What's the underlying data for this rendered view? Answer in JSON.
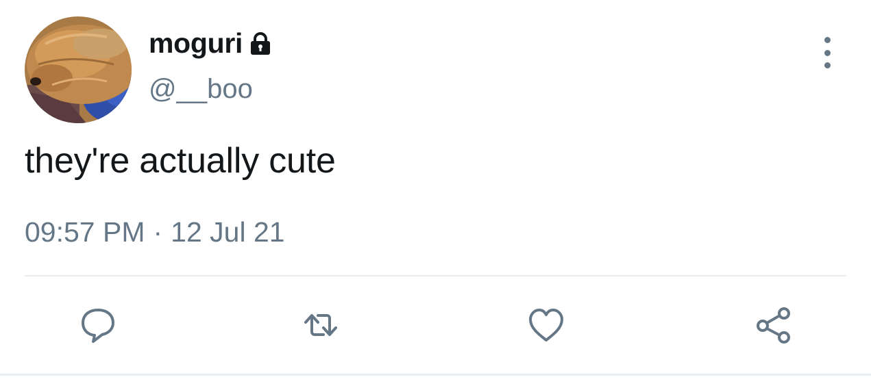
{
  "user": {
    "display_name": "moguri",
    "handle": "@__boo",
    "protected": true,
    "lock_icon": "lock-icon",
    "avatar_icon": "avatar-photo"
  },
  "tweet": {
    "text": "they're actually cute",
    "time": "09:57 PM",
    "separator": "·",
    "date": "12 Jul 21"
  },
  "actions": [
    {
      "name": "reply",
      "icon": "speech-bubble-icon"
    },
    {
      "name": "retweet",
      "icon": "retweet-icon"
    },
    {
      "name": "like",
      "icon": "heart-icon"
    },
    {
      "name": "share",
      "icon": "share-icon"
    }
  ],
  "more_menu": {
    "icon": "vertical-dots-icon"
  },
  "colors": {
    "text_primary": "#14171a",
    "text_secondary": "#657786",
    "divider": "#e6ecf0",
    "icon": "#657786"
  }
}
